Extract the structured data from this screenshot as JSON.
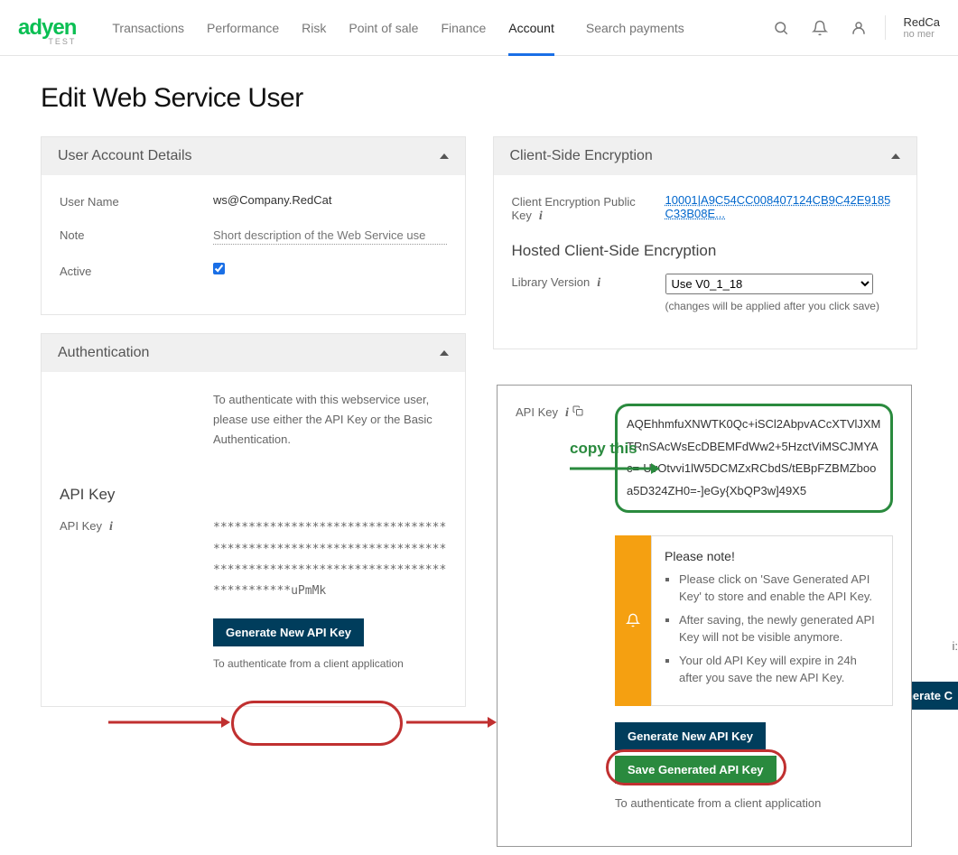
{
  "header": {
    "logo": "adyen",
    "logo_sub": "TEST",
    "nav": [
      "Transactions",
      "Performance",
      "Risk",
      "Point of sale",
      "Finance",
      "Account"
    ],
    "search_placeholder": "Search payments",
    "company": "RedCa",
    "company_sub": "no mer"
  },
  "page_title": "Edit Web Service User",
  "user_details": {
    "panel_title": "User Account Details",
    "username_label": "User Name",
    "username_value": "ws@Company.RedCat",
    "note_label": "Note",
    "note_placeholder": "Short description of the Web Service use",
    "active_label": "Active"
  },
  "auth": {
    "panel_title": "Authentication",
    "desc": "To authenticate with this webservice user, please use either the API Key or the Basic Authentication.",
    "api_key_section": "API Key",
    "api_key_label": "API Key",
    "masked_key": "**************************************************************************************************************uPmMk",
    "generate_btn": "Generate New API Key",
    "footer": "To authenticate from a client application"
  },
  "encryption": {
    "panel_title": "Client-Side Encryption",
    "pubkey_label": "Client Encryption Public Key",
    "pubkey_value": "10001|A9C54CC008407124CB9C42E9185C33B08E...",
    "hosted_title": "Hosted Client-Side Encryption",
    "libver_label": "Library Version",
    "libver_value": "Use V0_1_18",
    "libver_note": "(changes will be applied after you click save)"
  },
  "popup": {
    "api_key_label": "API Key",
    "copy_label": "copy this",
    "key_value": "AQEhhmfuXNWTK0Qc+iSCl2AbpvACcXTVlJXMTRnSAcWsEcDBEMFdWw2+5HzctViMSCJMYAc=-UvOtvvi1lW5DCMZxRCbdS/tEBpFZBMZbooa5D324ZH0=-]eGy{XbQP3w]49X5",
    "notice_title": "Please note!",
    "notice_items": [
      "Please click on 'Save Generated API Key' to store and enable the API Key.",
      "After saving, the newly generated API Key will not be visible anymore.",
      "Your old API Key will expire in 24h after you save the new API Key."
    ],
    "gen_btn": "Generate New API Key",
    "save_btn": "Save Generated API Key",
    "footer": "To authenticate from a client application"
  },
  "hidden": {
    "txt": "i:",
    "btn": "enerate C"
  }
}
